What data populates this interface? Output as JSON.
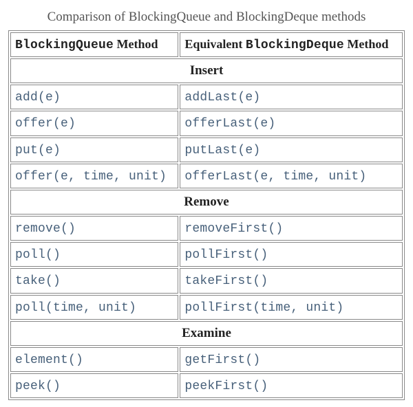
{
  "caption": "Comparison of BlockingQueue and BlockingDeque methods",
  "header": {
    "col1_code": "BlockingQueue",
    "col1_rest": " Method",
    "col2_pre": "Equivalent ",
    "col2_code": "BlockingDeque",
    "col2_rest": " Method"
  },
  "sections": {
    "insert": "Insert",
    "remove": "Remove",
    "examine": "Examine"
  },
  "rows": {
    "insert": [
      {
        "q": "add(e)",
        "d": "addLast(e)"
      },
      {
        "q": "offer(e)",
        "d": "offerLast(e)"
      },
      {
        "q": "put(e)",
        "d": "putLast(e)"
      },
      {
        "q": "offer(e, time, unit)",
        "d": "offerLast(e, time, unit)"
      }
    ],
    "remove": [
      {
        "q": "remove()",
        "d": "removeFirst()"
      },
      {
        "q": "poll()",
        "d": "pollFirst()"
      },
      {
        "q": "take()",
        "d": "takeFirst()"
      },
      {
        "q": "poll(time, unit)",
        "d": "pollFirst(time, unit)"
      }
    ],
    "examine": [
      {
        "q": "element()",
        "d": "getFirst()"
      },
      {
        "q": "peek()",
        "d": "peekFirst()"
      }
    ]
  },
  "chart_data": {
    "type": "table",
    "title": "Comparison of BlockingQueue and BlockingDeque methods",
    "columns": [
      "BlockingQueue Method",
      "Equivalent BlockingDeque Method"
    ],
    "sections": [
      {
        "name": "Insert",
        "rows": [
          [
            "add(e)",
            "addLast(e)"
          ],
          [
            "offer(e)",
            "offerLast(e)"
          ],
          [
            "put(e)",
            "putLast(e)"
          ],
          [
            "offer(e, time, unit)",
            "offerLast(e, time, unit)"
          ]
        ]
      },
      {
        "name": "Remove",
        "rows": [
          [
            "remove()",
            "removeFirst()"
          ],
          [
            "poll()",
            "pollFirst()"
          ],
          [
            "take()",
            "takeFirst()"
          ],
          [
            "poll(time, unit)",
            "pollFirst(time, unit)"
          ]
        ]
      },
      {
        "name": "Examine",
        "rows": [
          [
            "element()",
            "getFirst()"
          ],
          [
            "peek()",
            "peekFirst()"
          ]
        ]
      }
    ]
  }
}
